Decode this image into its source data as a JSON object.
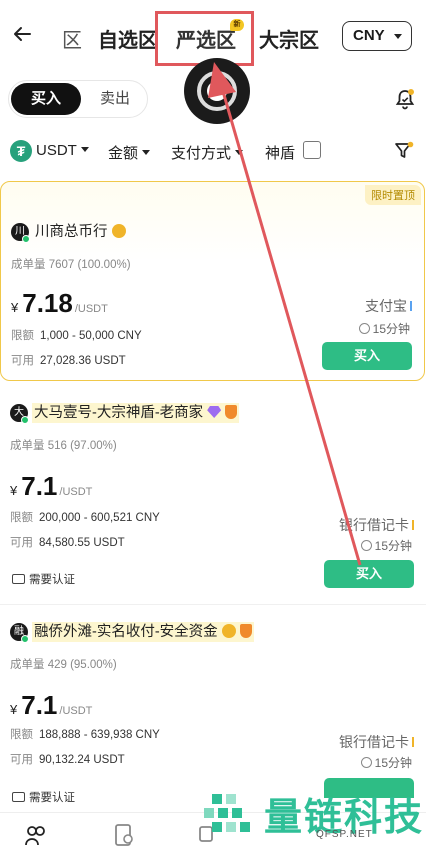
{
  "header": {
    "tabs": [
      {
        "label": "区"
      },
      {
        "label": "自选区"
      },
      {
        "label": "严选区",
        "badge": "新"
      },
      {
        "label": "大宗区"
      }
    ],
    "currency": "CNY"
  },
  "trade_toggle": {
    "buy": "买入",
    "sell": "卖出"
  },
  "filters": {
    "coin_icon": "₮",
    "coin": "USDT",
    "amount": "金额",
    "payment": "支付方式",
    "shield": "神盾"
  },
  "offers": [
    {
      "promo_tag": "限时置顶",
      "avatar": "川",
      "merchant": "川商总币行",
      "stats": "成单量 7607 (100.00%)",
      "currency_symbol": "¥",
      "price": "7.18",
      "unit": "/USDT",
      "limit_label": "限额",
      "limit_value": "1,000 - 50,000 CNY",
      "available_label": "可用",
      "available_value": "27,028.36 USDT",
      "payment_method": "支付宝",
      "time": "15分钟",
      "action": "买入"
    },
    {
      "avatar": "大",
      "merchant": "大马壹号-大宗神盾-老商家",
      "stats": "成单量 516 (97.00%)",
      "currency_symbol": "¥",
      "price": "7.1",
      "unit": "/USDT",
      "limit_label": "限额",
      "limit_value": "200,000 - 600,521 CNY",
      "available_label": "可用",
      "available_value": "84,580.55 USDT",
      "payment_method": "银行借记卡",
      "time": "15分钟",
      "action": "买入",
      "verify": "需要认证"
    },
    {
      "avatar": "融",
      "merchant": "融侨外滩-实名收付-安全资金",
      "stats": "成单量 429 (95.00%)",
      "currency_symbol": "¥",
      "price": "7.1",
      "unit": "/USDT",
      "limit_label": "限额",
      "limit_value": "188,888 - 639,938 CNY",
      "available_label": "可用",
      "available_value": "90,132.24 USDT",
      "payment_method": "银行借记卡",
      "time": "15分钟",
      "verify": "需要认证"
    }
  ],
  "watermark": {
    "title": "量链科技",
    "subtitle": "QFSP.NET"
  },
  "colors": {
    "buy_green": "#2ebd85",
    "highlight_red": "#e0585c",
    "promo_gold": "#f0c84a"
  },
  "icons": [
    "back-arrow-icon",
    "bell-icon",
    "filter-funnel-icon",
    "clock-icon",
    "id-card-icon"
  ]
}
